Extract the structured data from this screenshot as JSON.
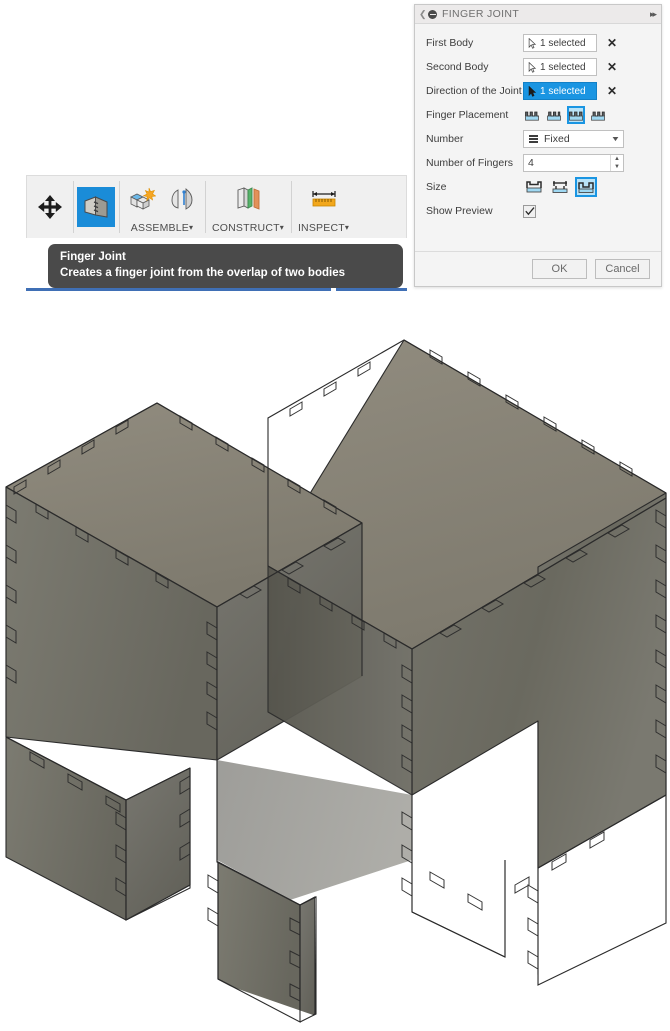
{
  "toolbar": {
    "groups": [
      {
        "name": "move",
        "label": "",
        "buttons": [
          {
            "icon": "move-arrows-icon",
            "name": "move-tool",
            "selected": false
          }
        ]
      },
      {
        "name": "finger-joint",
        "label": "",
        "buttons": [
          {
            "icon": "finger-joint-icon",
            "name": "finger-joint-tool",
            "selected": true
          }
        ]
      },
      {
        "name": "assemble",
        "label": "ASSEMBLE",
        "buttons": [
          {
            "icon": "new-component-icon",
            "name": "new-component-tool",
            "selected": false
          },
          {
            "icon": "joint-icon",
            "name": "joint-tool",
            "selected": false
          }
        ]
      },
      {
        "name": "construct",
        "label": "CONSTRUCT",
        "buttons": [
          {
            "icon": "offset-plane-icon",
            "name": "offset-plane-tool",
            "selected": false
          }
        ]
      },
      {
        "name": "inspect",
        "label": "INSPECT",
        "buttons": [
          {
            "icon": "measure-ruler-icon",
            "name": "measure-tool",
            "selected": false
          }
        ]
      }
    ],
    "caret": "▾"
  },
  "tooltip": {
    "title": "Finger Joint",
    "description": "Creates a finger joint from the overlap of two bodies"
  },
  "dialog": {
    "title": "FINGER JOINT",
    "collapse_glyph": "❮",
    "expand_glyph": "▸▸",
    "rows": {
      "first_body": {
        "label": "First Body",
        "value": "1 selected",
        "active": false,
        "clear_glyph": "✕"
      },
      "second_body": {
        "label": "Second Body",
        "value": "1 selected",
        "active": false,
        "clear_glyph": "✕"
      },
      "direction": {
        "label": "Direction of the Joint",
        "value": "1 selected",
        "active": true,
        "clear_glyph": "✕"
      },
      "finger_placement": {
        "label": "Finger Placement",
        "options": [
          {
            "name": "placement-option-1",
            "selected": false
          },
          {
            "name": "placement-option-2",
            "selected": false
          },
          {
            "name": "placement-option-3",
            "selected": true
          },
          {
            "name": "placement-option-4",
            "selected": false
          }
        ]
      },
      "number": {
        "label": "Number",
        "value": "Fixed",
        "caret": "▼",
        "options": [
          "Fixed"
        ]
      },
      "number_of_fingers": {
        "label": "Number of Fingers",
        "value": "4",
        "up_glyph": "▲",
        "down_glyph": "▼"
      },
      "size": {
        "label": "Size",
        "options": [
          {
            "name": "size-option-1",
            "selected": false
          },
          {
            "name": "size-option-2",
            "selected": false
          },
          {
            "name": "size-option-3",
            "selected": true
          }
        ]
      },
      "show_preview": {
        "label": "Show Preview",
        "checked": true
      }
    },
    "footer": {
      "ok": "OK",
      "cancel": "Cancel"
    }
  },
  "colors": {
    "accent_blue": "#1a95e2",
    "toolbar_selected": "#1a8cd8",
    "tooltip_bg": "#4a4a4a",
    "underline_blue": "#3f6fb5",
    "model_top": "#8a8578",
    "model_front": "#6e6d63",
    "model_side": "#7d7c71",
    "model_outline": "#2b2b2b",
    "canvas_bg": "#ffffff"
  },
  "model": {
    "name": "finger-jointed-box-assembly",
    "description": "Isometric gray 3D box assembly with finger joints along edges and two legs"
  }
}
